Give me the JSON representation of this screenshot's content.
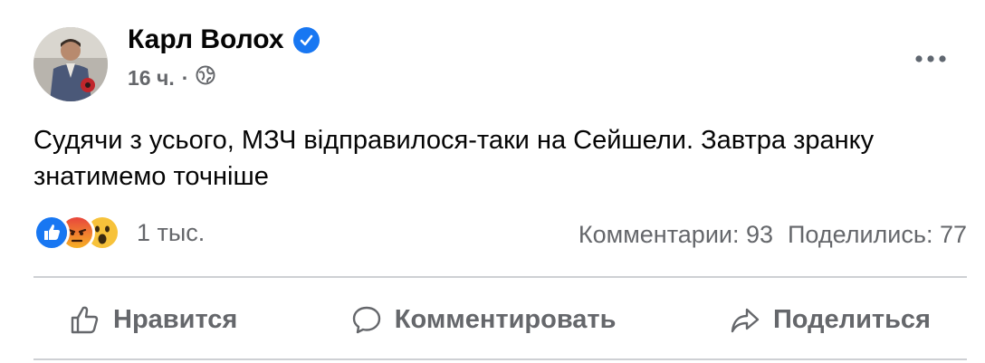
{
  "post": {
    "author": "Карл Волох",
    "time": "16 ч.",
    "separator": "·",
    "text": "Судячи з усього, МЗЧ відправилося-таки на Сейшели. Завтра зранку знатимемо точніше",
    "reactions": {
      "icons": [
        "like-icon",
        "angry-icon",
        "wow-icon"
      ],
      "count": "1 тыс."
    },
    "comments": "Комментарии: 93",
    "shares": "Поделились: 77"
  },
  "actions": {
    "like": "Нравится",
    "comment": "Комментировать",
    "share": "Поделиться"
  },
  "colors": {
    "brand_blue": "#1877f2",
    "secondary_text": "#65676b",
    "divider": "#ced0d4"
  }
}
